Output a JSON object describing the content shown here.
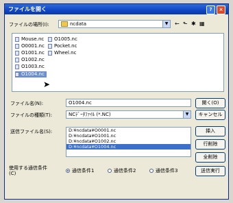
{
  "window": {
    "title": "ファイルを開く",
    "help_label": "?",
    "close_label": "×"
  },
  "look_in": {
    "label": "ファイルの場所(I):",
    "value": "ncdata"
  },
  "toolbar": {
    "back": "←",
    "up": "⬑",
    "new_folder": "✱",
    "view": "▦"
  },
  "files": [
    "Mouse.nc",
    "O0001.nc",
    "O1001.nc",
    "O1002.nc",
    "O1003.nc",
    "O1004.nc",
    "O1005.nc",
    "Pocket.nc",
    "Wheel.nc"
  ],
  "filename": {
    "label": "ファイル名(N):",
    "value": "O1004.nc"
  },
  "filetype": {
    "label": "ファイルの種類(T):",
    "value": "NCﾃﾞｰﾀﾌｧｲﾙ (*.NC)"
  },
  "buttons": {
    "open": "開く(O)",
    "cancel": "キャンセル",
    "insert": "挿入",
    "delete_line": "行削除",
    "delete_all": "全削除",
    "run": "送信実行"
  },
  "send_files": {
    "label": "送信ファイル名(S):",
    "items": [
      "D:¥ncdata¥O0001.nc",
      "D:¥ncdata¥O1001.nc",
      "D:¥ncdata¥O1002.nc",
      "D:¥ncdata¥O1004.nc"
    ]
  },
  "conditions": {
    "label_line1": "使用する通信条件",
    "label_line2": "(C)",
    "options": [
      "通信条件1",
      "通信条件2",
      "通信条件3"
    ],
    "selected": "通信条件1"
  }
}
